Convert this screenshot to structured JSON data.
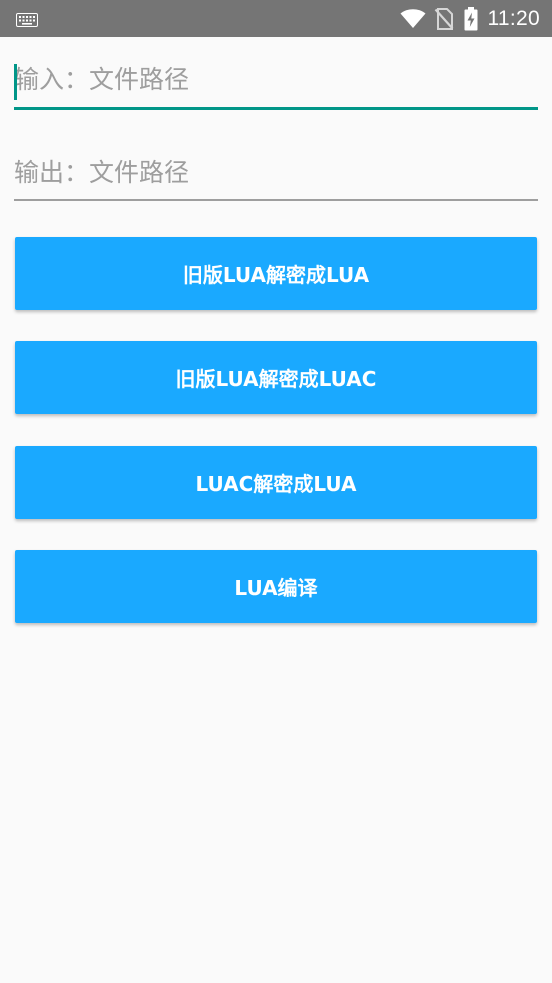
{
  "status_bar": {
    "time": "11:20",
    "icons": [
      "keyboard-icon",
      "wifi-icon",
      "no-sim-icon",
      "battery-charging-icon"
    ],
    "background": "#757575"
  },
  "input_field": {
    "placeholder": "输入：文件路径",
    "value": "",
    "accent_color": "#009688"
  },
  "output_field": {
    "placeholder": "输出：文件路径",
    "value": ""
  },
  "buttons": [
    {
      "label": "旧版LUA解密成LUA"
    },
    {
      "label": "旧版LUA解密成LUAC"
    },
    {
      "label": "LUAC解密成LUA"
    },
    {
      "label": "LUA编译"
    }
  ],
  "colors": {
    "button_bg": "#1aa9ff",
    "button_text": "#ffffff",
    "page_bg": "#fafafa"
  }
}
